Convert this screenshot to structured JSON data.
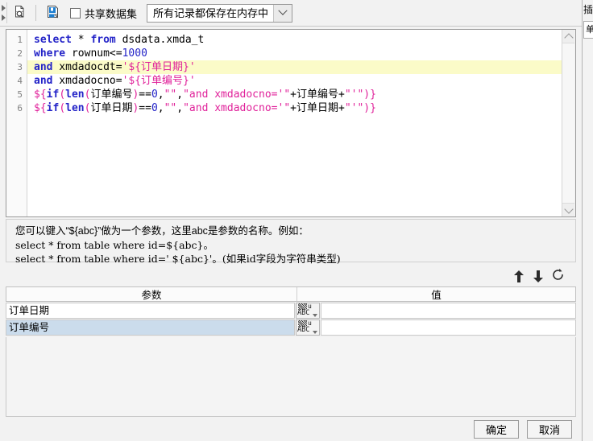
{
  "toolbar": {
    "preview_icon": "document-search-icon",
    "save_icon": "save-dataset-icon",
    "share_checkbox_label": "共享数据集",
    "share_checkbox_checked": false,
    "storage_combo_value": "所有记录都保存在内存中",
    "storage_combo_arrow": "chevron-down-icon"
  },
  "editor": {
    "line_numbers": [
      "1",
      "2",
      "3",
      "4",
      "5",
      "6"
    ],
    "lines": [
      {
        "highlight": false,
        "text": "select * from dsdata.xmda_t"
      },
      {
        "highlight": false,
        "text": "where rownum<=1000"
      },
      {
        "highlight": true,
        "text": "and xmdadocdt='${订单日期}'"
      },
      {
        "highlight": false,
        "text": "and xmdadocno='${订单编号}'"
      },
      {
        "highlight": false,
        "text": "${if(len(订单编号)==0,\"\",\"and xmdadocno='\"+订单编号+\"'\")}"
      },
      {
        "highlight": false,
        "text": "${if(len(订单日期)==0,\"\",\"and xmdadocno='\"+订单日期+\"'\")}"
      }
    ],
    "scroll_up_icon": "chevron-up-icon",
    "scroll_down_icon": "chevron-down-icon"
  },
  "hint": {
    "line1": "您可以键入“${abc}”做为一个参数，这里abc是参数的名称。例如：",
    "line2": "select * from table where id=${abc}。",
    "line3": "select * from table where id=' ${abc}'。(如果id字段为字符串类型)"
  },
  "actions": {
    "move_up_icon": "arrow-up-icon",
    "move_down_icon": "arrow-down-icon",
    "refresh_icon": "refresh-icon"
  },
  "param_table": {
    "headers": [
      "参数",
      "值"
    ],
    "rows": [
      {
        "name": "订单日期",
        "type_icon": "string-type-icon",
        "type_label": "ABC",
        "value": "",
        "selected": false
      },
      {
        "name": "订单编号",
        "type_icon": "string-type-icon",
        "type_label": "ABC",
        "value": "",
        "selected": true
      }
    ]
  },
  "footer": {
    "ok_label": "确定",
    "cancel_label": "取消"
  },
  "right_sliver": {
    "title": "插",
    "box_text": "单"
  },
  "colors": {
    "keyword": "#2424c8",
    "string": "#e0219a",
    "number": "#2424c8",
    "highlight_line": "#fbfbc8",
    "selected_row": "#cbdcec",
    "dialog_bg": "#f2f2f2"
  }
}
